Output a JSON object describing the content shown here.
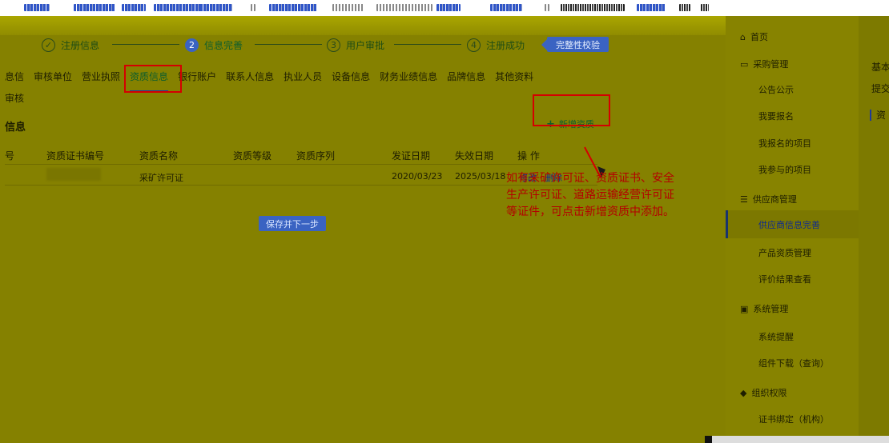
{
  "steps": [
    {
      "index": "✓",
      "label": "注册信息",
      "state": "done"
    },
    {
      "index": "2",
      "label": "信息完善",
      "state": "active"
    },
    {
      "index": "3",
      "label": "用户审批",
      "state": "todo"
    },
    {
      "index": "4",
      "label": "注册成功",
      "state": "todo"
    }
  ],
  "steps_button": "完整性校验",
  "tabs": [
    {
      "label": "息信",
      "active": false
    },
    {
      "label": "审核单位",
      "active": false
    },
    {
      "label": "营业执照",
      "active": false
    },
    {
      "label": "资质信息",
      "active": true
    },
    {
      "label": "银行账户",
      "active": false
    },
    {
      "label": "联系人信息",
      "active": false
    },
    {
      "label": "执业人员",
      "active": false
    },
    {
      "label": "设备信息",
      "active": false
    },
    {
      "label": "财务业绩信息",
      "active": false
    },
    {
      "label": "品牌信息",
      "active": false
    },
    {
      "label": "其他资料",
      "active": false
    }
  ],
  "sub_tab": "审核",
  "section_title": "信息",
  "add_button": "新增资质",
  "table": {
    "headers": [
      "号",
      "资质证书编号",
      "资质名称",
      "资质等级",
      "资质序列",
      "发证日期",
      "失效日期",
      "操 作"
    ],
    "rows": [
      {
        "name": "采矿许可证",
        "level": "",
        "series": "",
        "issue": "2020/03/23",
        "expire": "2025/03/18",
        "edit": "修改",
        "delete": "删除"
      }
    ]
  },
  "save_button": "保存并下一步",
  "annotation": "如有采矿许可证、资质证书、安全生产许可证、道路运输经营许可证等证件，可点击新增资质中添加。",
  "sidebar": {
    "home": "首页",
    "sections": [
      {
        "title": "采购管理",
        "icon": "folder-icon",
        "items": [
          "公告公示",
          "我要报名",
          "我报名的项目",
          "我参与的项目"
        ]
      },
      {
        "title": "供应商管理",
        "icon": "clipboard-icon",
        "items": [
          "供应商信息完善",
          "产品资质管理",
          "评价结果查看"
        ]
      },
      {
        "title": "系统管理",
        "icon": "monitor-icon",
        "items": [
          "系统提醒",
          "组件下载（查询）"
        ]
      },
      {
        "title": "组织权限",
        "icon": "shield-icon",
        "items": [
          "证书绑定（机构）"
        ]
      }
    ],
    "active_item": "供应商信息完善"
  },
  "right_panel": [
    "基本",
    "提交",
    "资"
  ],
  "colors": {
    "accent": "#3a63c2",
    "highlight": "#d40000",
    "note": "#b30000"
  }
}
